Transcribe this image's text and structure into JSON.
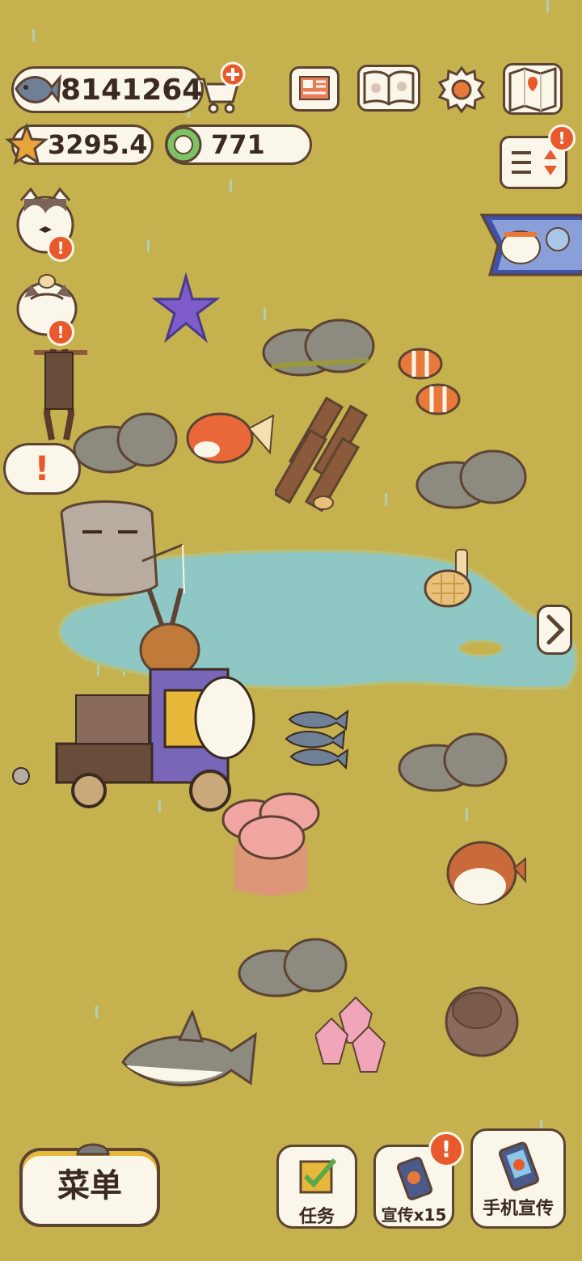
{
  "currency": {
    "fish": "8141264",
    "stars": "3295.4",
    "gems": "771"
  },
  "speech_bubble": "!",
  "badges": {
    "alert": "!"
  },
  "bottom": {
    "menu_label": "菜单",
    "tasks_label": "任务",
    "promote_label": "宣传x15",
    "phone_promote_label": "手机宣传"
  },
  "colors": {
    "grass": "#c6b14f",
    "pond": "#8fc7c4",
    "alert": "#e85a2c",
    "outline": "#5c4332",
    "cream": "#fbf6ea"
  },
  "icons": [
    "fish-icon",
    "cart-plus-icon",
    "newspaper-icon",
    "paw-book-icon",
    "gear-icon",
    "map-icon",
    "sort-icon",
    "star-icon",
    "gem-icon",
    "arrow-right-icon",
    "checklist-icon",
    "phone-icon"
  ]
}
